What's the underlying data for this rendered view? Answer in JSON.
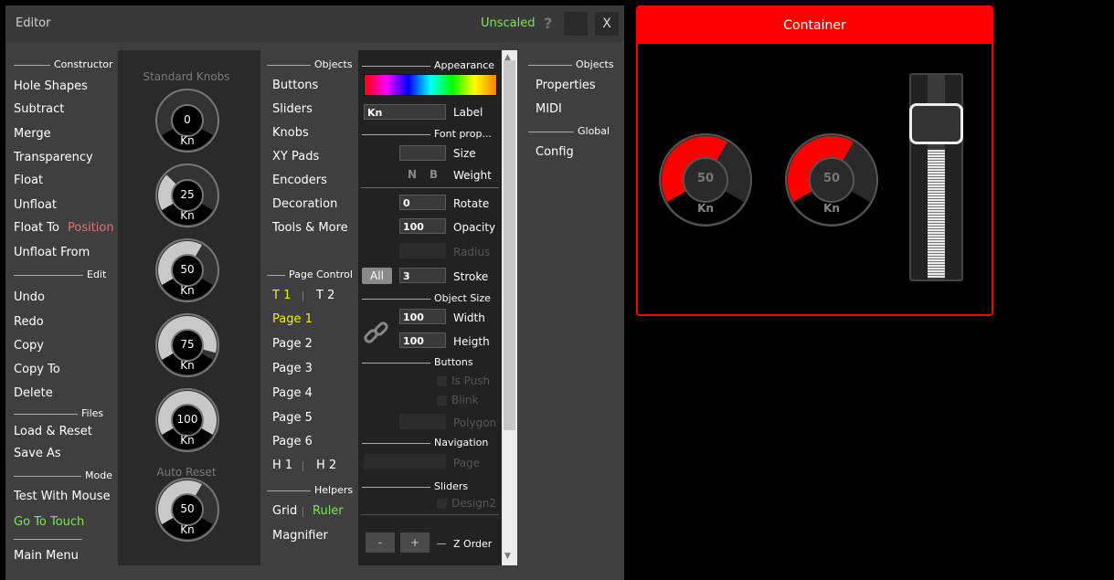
{
  "titlebar": {
    "title": "Editor",
    "scale": "Unscaled",
    "help": "?",
    "close": "X"
  },
  "left": {
    "constructor": "Constructor",
    "c_items": [
      "Hole Shapes",
      "Subtract",
      "Merge",
      "Transparency",
      "Float",
      "Unfloat"
    ],
    "float_to": "Float To",
    "position": "Position",
    "unfloat_from": "Unfloat From",
    "edit": "Edit",
    "e_items": [
      "Undo",
      "Redo",
      "Copy",
      "Copy To",
      "Delete"
    ],
    "files": "Files",
    "f_items": [
      "Load & Reset",
      "Save As"
    ],
    "mode": "Mode",
    "test_mouse": "Test With Mouse",
    "go_touch": "Go To Touch",
    "main_menu": "Main Menu"
  },
  "knobs": {
    "title": "Standard Knobs",
    "auto_reset": "Auto Reset",
    "unit": "Kn",
    "list": [
      {
        "value": "0",
        "level": 0
      },
      {
        "value": "25",
        "level": 25
      },
      {
        "value": "50",
        "level": 50
      },
      {
        "value": "75",
        "level": 75
      },
      {
        "value": "100",
        "level": 100
      },
      {
        "value": "50",
        "level": 50
      }
    ]
  },
  "objects": {
    "title": "Objects",
    "items": [
      "Buttons",
      "Sliders",
      "Knobs",
      "XY Pads",
      "Encoders",
      "Decoration",
      "Tools & More"
    ],
    "page_control": "Page Control",
    "t1": "T 1",
    "t2": "T 2",
    "pages": [
      "Page 1",
      "Page 2",
      "Page 3",
      "Page 4",
      "Page 5",
      "Page 6"
    ],
    "h1": "H 1",
    "h2": "H 2",
    "helpers": "Helpers",
    "grid": "Grid",
    "ruler": "Ruler",
    "magnifier": "Magnifier"
  },
  "appearance": {
    "title": "Appearance",
    "label_value": "Kn",
    "label": "Label",
    "font_prop": "Font prop...",
    "size": "Size",
    "n": "N",
    "b": "B",
    "weight": "Weight",
    "rotate_value": "0",
    "rotate": "Rotate",
    "opacity_value": "100",
    "opacity": "Opacity",
    "radius": "Radius",
    "all": "All",
    "stroke_value": "3",
    "stroke": "Stroke",
    "object_size": "Object Size",
    "width_value": "100",
    "width": "Width",
    "height_value": "100",
    "height": "Heigth",
    "buttons": "Buttons",
    "is_push": "Is Push",
    "blink": "Blink",
    "polygon": "Polygon",
    "navigation": "Navigation",
    "page": "Page",
    "sliders": "Sliders",
    "design2": "Design2",
    "minus": "-",
    "plus": "+",
    "z_order": "Z Order"
  },
  "right": {
    "objects": "Objects",
    "properties": "Properties",
    "midi": "MIDI",
    "global": "Global",
    "config": "Config"
  },
  "container": {
    "title": "Container",
    "knob_unit": "Kn",
    "knobs": [
      {
        "value": "50",
        "level": 50
      },
      {
        "value": "50",
        "level": 50
      }
    ]
  },
  "colors": {
    "accent": "#ff0000",
    "green": "#7fe25a",
    "yellow": "#f0f000"
  }
}
